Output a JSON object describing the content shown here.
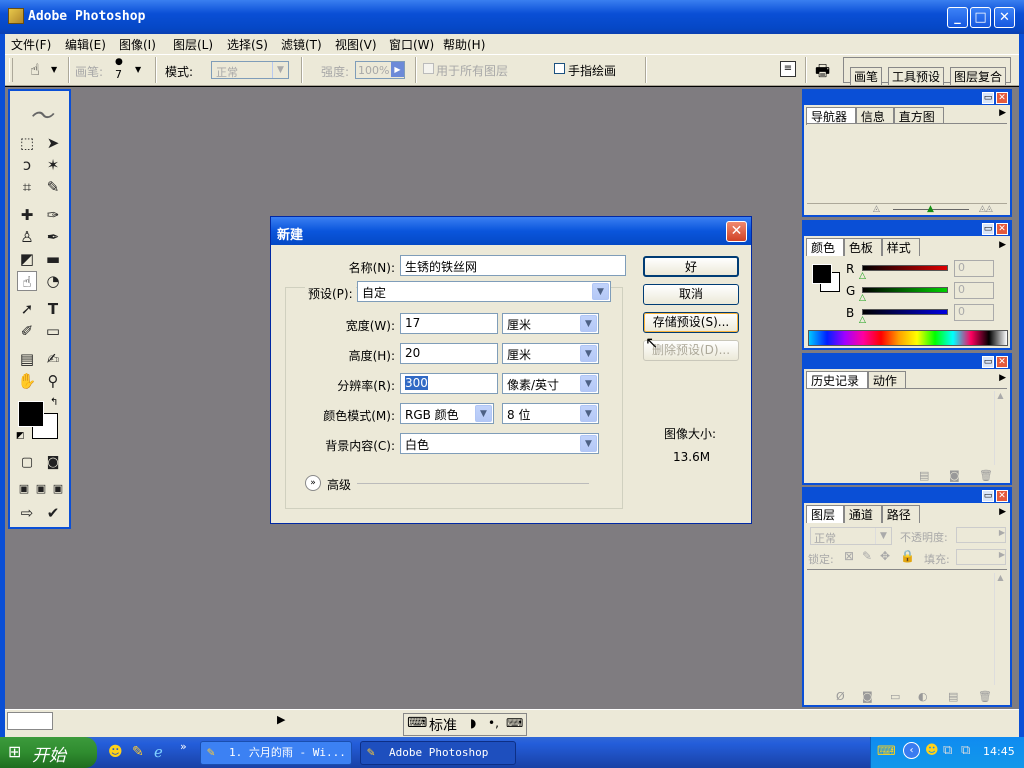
{
  "window": {
    "title": "Adobe Photoshop"
  },
  "menubar": [
    "文件(F)",
    "编辑(E)",
    "图像(I)",
    "图层(L)",
    "选择(S)",
    "滤镜(T)",
    "视图(V)",
    "窗口(W)",
    "帮助(H)"
  ],
  "options": {
    "brush_label": "画笔:",
    "brush_size": "7",
    "mode_label": "模式:",
    "mode_value": "正常",
    "strength_label": "强度:",
    "strength_value": "100%",
    "all_layers": "用于所有图层",
    "finger_paint": "手指绘画",
    "well_tabs": [
      "画笔",
      "工具预设",
      "图层复合"
    ]
  },
  "navigator_panel": {
    "tabs": [
      "导航器",
      "信息",
      "直方图"
    ]
  },
  "color_panel": {
    "tabs": [
      "颜色",
      "色板",
      "样式"
    ],
    "channels": [
      "R",
      "G",
      "B"
    ],
    "values": [
      "0",
      "0",
      "0"
    ]
  },
  "history_panel": {
    "tabs": [
      "历史记录",
      "动作"
    ]
  },
  "layers_panel": {
    "tabs": [
      "图层",
      "通道",
      "路径"
    ],
    "blend_mode": "正常",
    "opacity_label": "不透明度:",
    "lock_label": "锁定:",
    "fill_label": "填充:"
  },
  "dialog": {
    "title": "新建",
    "name_label": "名称(N):",
    "name_value": "生锈的铁丝网",
    "preset_label": "预设(P):",
    "preset_value": "自定",
    "width_label": "宽度(W):",
    "width_value": "17",
    "width_unit": "厘米",
    "height_label": "高度(H):",
    "height_value": "20",
    "height_unit": "厘米",
    "resolution_label": "分辨率(R):",
    "resolution_value": "300",
    "resolution_unit": "像素/英寸",
    "colormode_label": "颜色模式(M):",
    "colormode_value": "RGB 颜色",
    "bitdepth_value": "8 位",
    "background_label": "背景内容(C):",
    "background_value": "白色",
    "advanced_label": "高级",
    "ok_button": "好",
    "cancel_button": "取消",
    "save_preset_button": "存储预设(S)...",
    "delete_preset_button": "删除预设(D)...",
    "image_size_label": "图像大小:",
    "image_size_value": "13.6M"
  },
  "ime": {
    "mode": "标准"
  },
  "taskbar": {
    "start": "开始",
    "items": [
      "1. 六月的雨 - Wi...",
      "Adobe Photoshop"
    ],
    "clock": "14:45"
  },
  "colors": {
    "xp_blue": "#0a4fd6",
    "canvas_gray": "#7f7c80",
    "face": "#ece9d8"
  }
}
